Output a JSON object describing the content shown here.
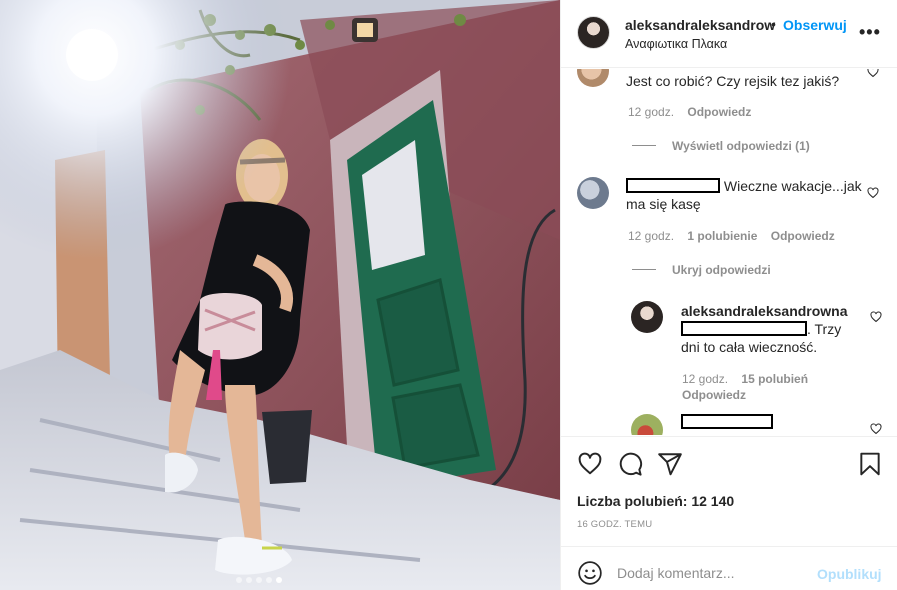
{
  "photo": {
    "alt": "",
    "slides": 5,
    "active_slide": 1
  },
  "header": {
    "username": "aleksandraleksandrow",
    "separator": "•",
    "follow_label": "Obserwuj",
    "location": "Αναφιωτικα Πλακα",
    "more_label": "•••"
  },
  "comments": [
    {
      "text": "Jest co robić? Czy rejsik tez jakiś?",
      "time": "12 godz.",
      "reply_label": "Odpowiedz"
    },
    {
      "toggle_label": "Wyświetl odpowiedzi (1)"
    },
    {
      "text": " Wieczne wakacje...jak ma się kasę",
      "time": "12 godz.",
      "likes": "1 polubienie",
      "reply_label": "Odpowiedz"
    },
    {
      "toggle_label": "Ukryj odpowiedzi"
    },
    {
      "username": "aleksandraleksandrowna",
      "text": ". Trzy dni to cała wieczność.",
      "time": "12 godz.",
      "likes": "15 polubień",
      "reply_label": "Odpowiedz"
    }
  ],
  "actions": {
    "like_icon": "heart-icon",
    "comment_icon": "comment-icon",
    "share_icon": "paper-plane-icon",
    "save_icon": "bookmark-icon"
  },
  "likes_text": "Liczba polubień: 12 140",
  "time_ago": "16 godz. temu",
  "add_comment": {
    "placeholder": "Dodaj komentarz...",
    "publish_label": "Opublikuj"
  },
  "colors": {
    "link_blue": "#0095f6",
    "publish_disabled": "#b2dffc",
    "meta_gray": "#8e8e8e",
    "text": "#262626"
  }
}
